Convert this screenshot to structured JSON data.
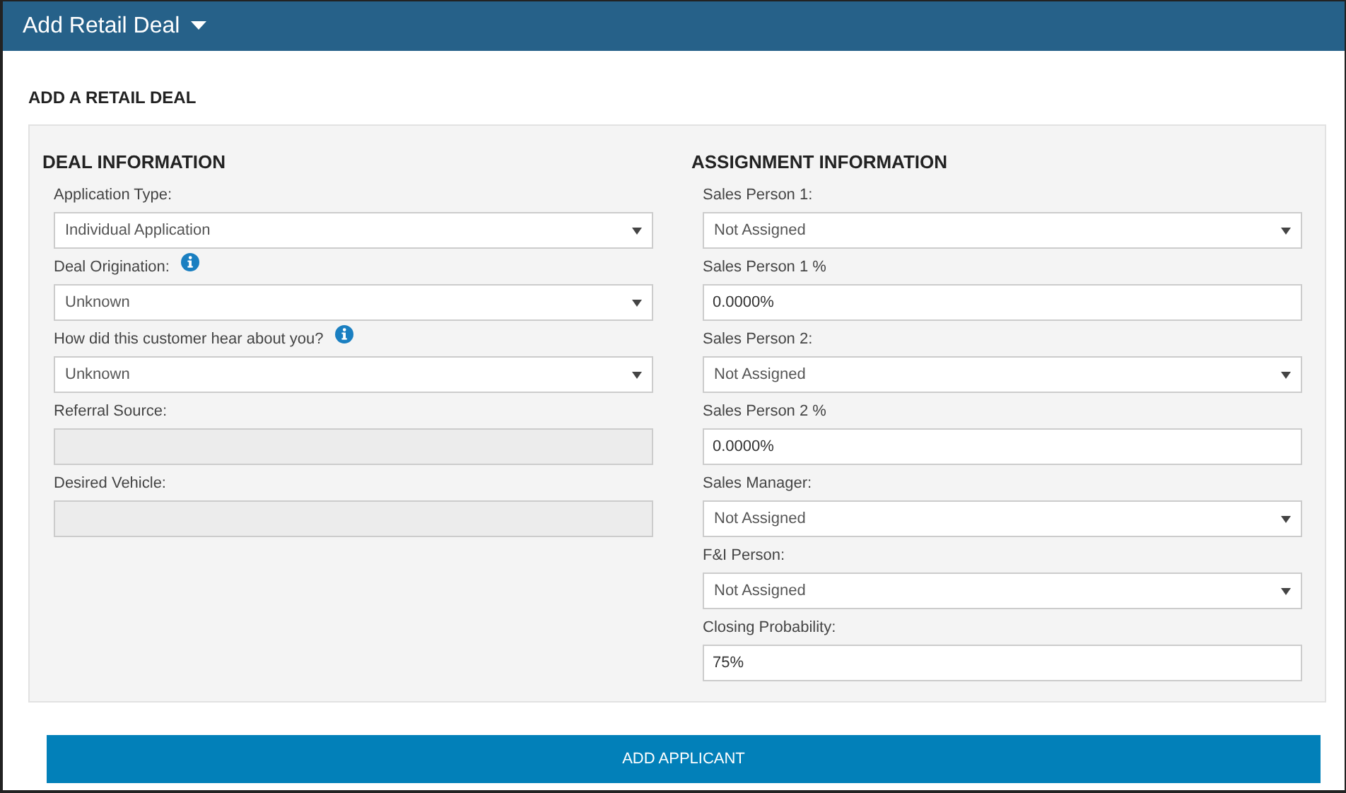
{
  "header": {
    "title": "Add Retail Deal"
  },
  "page_title": "ADD A RETAIL DEAL",
  "sections": [
    {
      "heading": "DEAL INFORMATION",
      "fields": [
        {
          "label": "Application Type:",
          "kind": "select",
          "value": "Individual Application",
          "info": false
        },
        {
          "label": "Deal Origination:",
          "kind": "select",
          "value": "Unknown",
          "info": true
        },
        {
          "label": "How did this customer hear about you?",
          "kind": "select",
          "value": "Unknown",
          "info": true
        },
        {
          "label": "Referral Source:",
          "kind": "text",
          "disabled": true,
          "info": false
        },
        {
          "label": "Desired Vehicle:",
          "kind": "text",
          "disabled": true,
          "info": false
        }
      ]
    },
    {
      "heading": "ASSIGNMENT INFORMATION",
      "fields": [
        {
          "label": "Sales Person 1:",
          "kind": "select",
          "value": "Not Assigned",
          "info": false
        },
        {
          "label": "Sales Person 1 %",
          "kind": "text",
          "value": "0.0000%",
          "disabled": false,
          "info": false
        },
        {
          "label": "Sales Person 2:",
          "kind": "select",
          "value": "Not Assigned",
          "info": false
        },
        {
          "label": "Sales Person 2 %",
          "kind": "text",
          "value": "0.0000%",
          "disabled": false,
          "info": false
        },
        {
          "label": "Sales Manager:",
          "kind": "select",
          "value": "Not Assigned",
          "info": false
        },
        {
          "label": "F&I Person:",
          "kind": "select",
          "value": "Not Assigned",
          "info": false
        },
        {
          "label": "Closing Probability:",
          "kind": "text",
          "value": "75%",
          "disabled": false,
          "info": false
        }
      ]
    }
  ],
  "primary_button": "ADD APPLICANT"
}
